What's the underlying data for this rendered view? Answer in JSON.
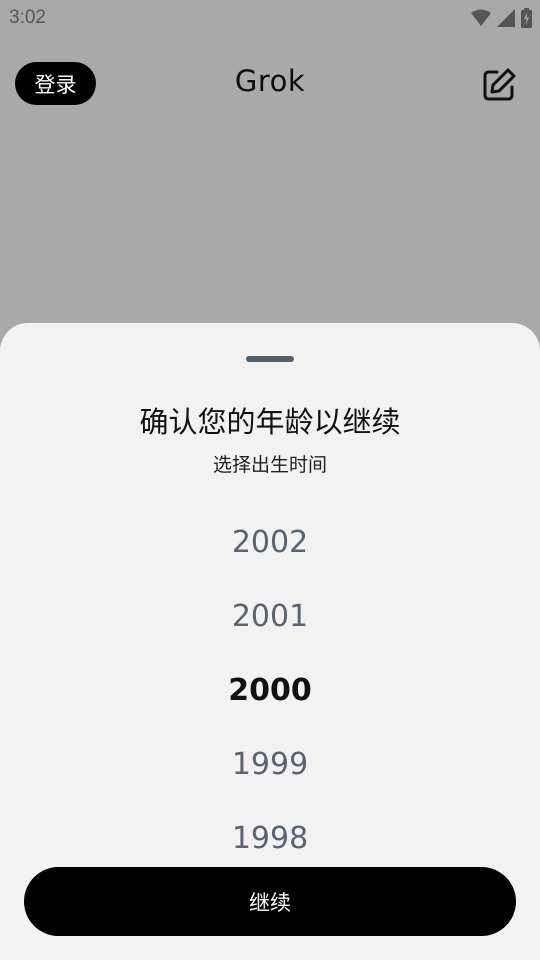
{
  "status_bar": {
    "time": "3:02",
    "icons": [
      "wifi-icon",
      "cellular-signal-icon",
      "battery-charging-icon"
    ]
  },
  "app_bar": {
    "login_label": "登录",
    "title": "Grok",
    "edit_icon": "edit-square-icon"
  },
  "sheet": {
    "title": "确认您的年龄以继续",
    "subtitle": "选择出生时间",
    "years": [
      "2002",
      "2001",
      "2000",
      "1999",
      "1998"
    ],
    "selected_year": "2000",
    "continue_label": "继续"
  },
  "colors": {
    "scrim": "#a9a9a9",
    "sheet_background": "#f2f2f2",
    "primary_button": "#000000",
    "unselected_year": "#5a6470"
  }
}
